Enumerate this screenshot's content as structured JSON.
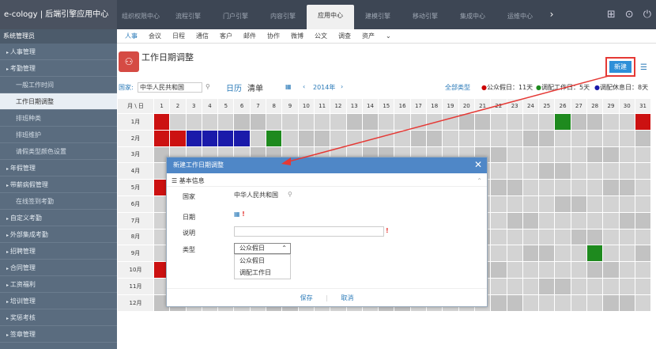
{
  "app": {
    "brand": "e-cology | 后端引擎应用中心"
  },
  "topnav": [
    "组织权限中心",
    "流程引擎",
    "门户引擎",
    "内容引擎",
    "应用中心",
    "建模引擎",
    "移动引擎",
    "集成中心",
    "运维中心"
  ],
  "sidebar": {
    "title": "系统管理员",
    "items": [
      {
        "label": "人事管理",
        "level": 1
      },
      {
        "label": "考勤管理",
        "level": 1
      },
      {
        "label": "一般工作时间",
        "level": 2
      },
      {
        "label": "工作日期调整",
        "level": 2,
        "active": true
      },
      {
        "label": "排班种类",
        "level": 2
      },
      {
        "label": "排班维护",
        "level": 2
      },
      {
        "label": "请假类型颜色设置",
        "level": 2
      },
      {
        "label": "年假管理",
        "level": 1
      },
      {
        "label": "带薪病假管理",
        "level": 1
      },
      {
        "label": "在线签到考勤",
        "level": 2
      },
      {
        "label": "自定义考勤",
        "level": 1
      },
      {
        "label": "外部集成考勤",
        "level": 1
      },
      {
        "label": "招聘管理",
        "level": 1
      },
      {
        "label": "合同管理",
        "level": 1
      },
      {
        "label": "工资福利",
        "level": 1
      },
      {
        "label": "培训管理",
        "level": 1
      },
      {
        "label": "奖惩考核",
        "level": 1
      },
      {
        "label": "签章管理",
        "level": 1
      }
    ]
  },
  "subnav": [
    "人事",
    "会议",
    "日程",
    "通信",
    "客户",
    "邮件",
    "协作",
    "微博",
    "公文",
    "调查",
    "资产"
  ],
  "page": {
    "title": "工作日期调整",
    "new_button": "新建"
  },
  "filter": {
    "country_label": "国家:",
    "country_value": "中华人民共和国",
    "view_calendar": "日历",
    "view_list": "清单",
    "year": "2014年",
    "all_types": "全部类型",
    "legend": [
      {
        "label": "公众假日：11天",
        "color": "#cc0000"
      },
      {
        "label": "调配工作日：5天",
        "color": "#1e8a1e"
      },
      {
        "label": "调配休息日：8天",
        "color": "#1a1aaa"
      }
    ]
  },
  "calendar": {
    "corner": "月 \\ 日",
    "days": [
      "1",
      "2",
      "3",
      "4",
      "5",
      "6",
      "7",
      "8",
      "9",
      "10",
      "11",
      "12",
      "13",
      "14",
      "15",
      "16",
      "17",
      "18",
      "19",
      "20",
      "21",
      "22",
      "23",
      "24",
      "25",
      "26",
      "27",
      "28",
      "29",
      "30",
      "31"
    ],
    "months": [
      "1月",
      "2月",
      "3月",
      "4月",
      "5月",
      "6月",
      "7月",
      "8月",
      "9月",
      "10月",
      "11月",
      "12月"
    ],
    "colors": {
      "holiday": "#cc1111",
      "workday": "#1e8a1e",
      "restday": "#1a1aaa"
    }
  },
  "modal": {
    "title": "新建工作日期调整",
    "section": "基本信息",
    "country_label": "国家",
    "country_value": "中华人民共和国",
    "date_label": "日期",
    "desc_label": "说明",
    "type_label": "类型",
    "type_value": "公众假日",
    "type_options": [
      "公众假日",
      "调配工作日"
    ],
    "save": "保存",
    "cancel": "取消"
  }
}
